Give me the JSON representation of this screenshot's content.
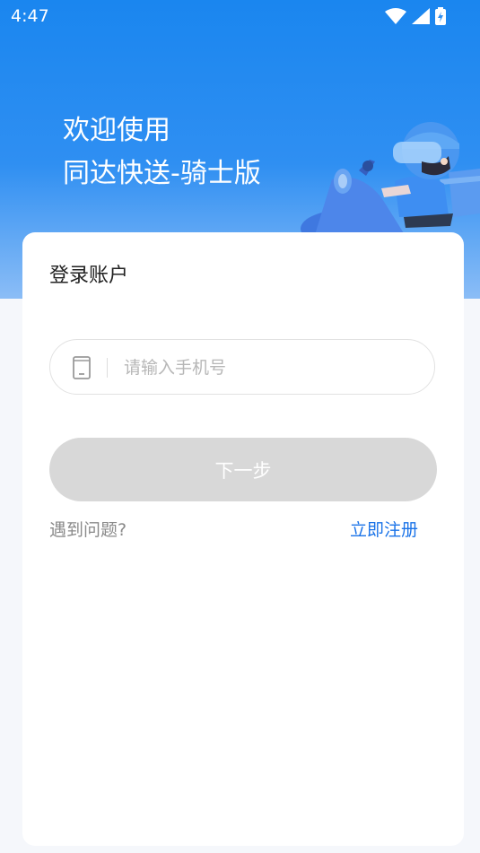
{
  "status_bar": {
    "time": "4:47",
    "icons": [
      "wifi-icon",
      "cell-signal-icon",
      "battery-charging-icon"
    ]
  },
  "hero": {
    "welcome_line1": "欢迎使用",
    "welcome_line2": "同达快送-骑士版",
    "illustration": "delivery-rider-illustration"
  },
  "login_card": {
    "title": "登录账户",
    "phone_input": {
      "placeholder": "请输入手机号",
      "value": "",
      "icon": "phone-icon"
    },
    "next_button": "下一步",
    "help_link": "遇到问题?",
    "register_link": "立即注册"
  },
  "colors": {
    "primary_blue": "#1a86ef",
    "link_blue": "#1a73e8",
    "disabled_button": "#d8d8d8",
    "page_background": "#f5f7fb"
  }
}
